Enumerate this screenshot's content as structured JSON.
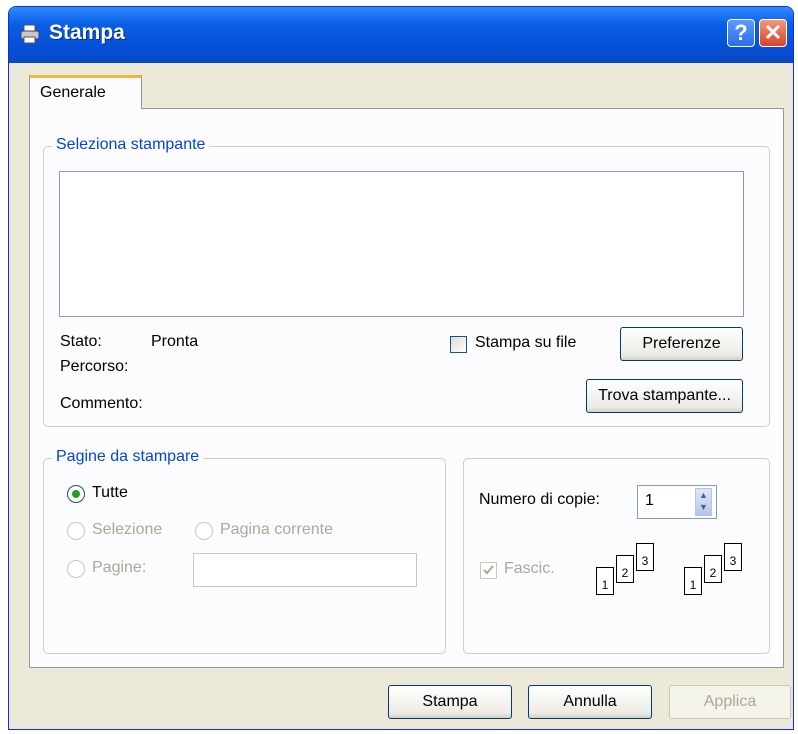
{
  "window": {
    "title": "Stampa",
    "help_label": "?",
    "close_label": "✕"
  },
  "tabs": [
    {
      "label": "Generale"
    }
  ],
  "printer_group": {
    "legend": "Seleziona stampante",
    "status_label": "Stato:",
    "status_value": "Pronta",
    "path_label": "Percorso:",
    "comment_label": "Commento:",
    "print_to_file_label": "Stampa su file",
    "print_to_file_checked": false,
    "preferences_button": "Preferenze",
    "find_printer_button": "Trova stampante..."
  },
  "pages_group": {
    "legend": "Pagine da stampare",
    "all_label": "Tutte",
    "all_selected": true,
    "selection_label": "Selezione",
    "current_page_label": "Pagina corrente",
    "pages_label": "Pagine:",
    "pages_value": ""
  },
  "copies_group": {
    "copies_label": "Numero di copie:",
    "copies_value": "1",
    "collate_label": "Fascic.",
    "collate_checked": true,
    "collate_pages": [
      "1",
      "2",
      "3"
    ],
    "uncollated_pages": [
      "1",
      "2",
      "3"
    ]
  },
  "buttons": {
    "print": "Stampa",
    "cancel": "Annulla",
    "apply": "Applica"
  },
  "colors": {
    "title_bar": "#0550d8",
    "legend_text": "#0046d5",
    "tab_highlight": "#f5b53c"
  },
  "icons": {
    "app": "printer-icon",
    "help": "help-icon",
    "close": "close-icon",
    "spinner": "spinner-arrows-icon"
  }
}
